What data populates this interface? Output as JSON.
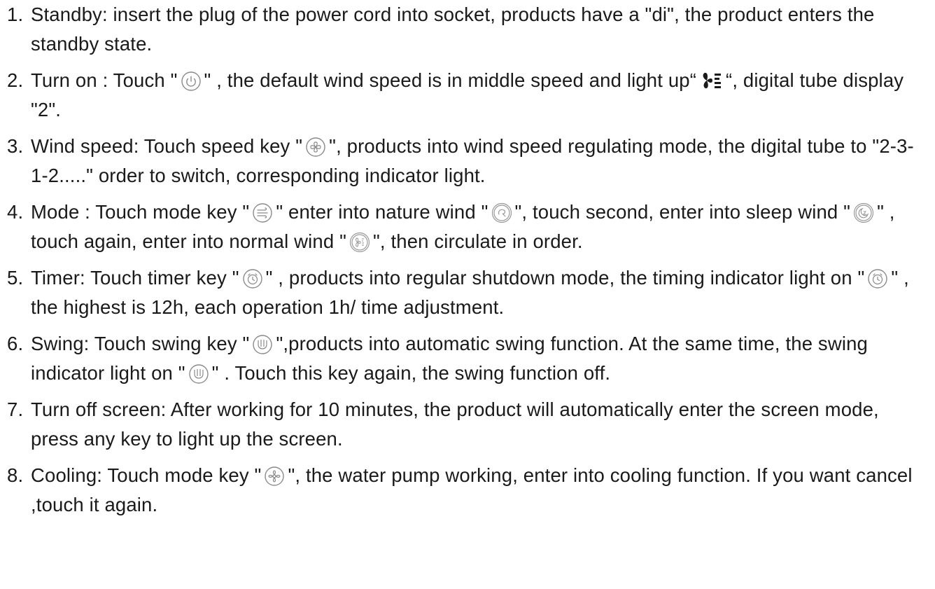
{
  "document": {
    "items": [
      {
        "number": "1.",
        "parts": [
          "Standby: insert the plug of the power cord into socket, products have a \"di\", the product enters the standby state."
        ]
      },
      {
        "number": "2.",
        "parts": [
          "Turn on : Touch \"",
          "\" , the default wind speed is in middle speed and light up“",
          "“, digital tube display \"2\"."
        ]
      },
      {
        "number": "3.",
        "parts": [
          "Wind speed: Touch speed key \"",
          "\", products into wind speed regulating mode, the digital tube to \"2-3-1-2.....\" order to switch, corresponding indicator light."
        ]
      },
      {
        "number": "4.",
        "parts": [
          "Mode : Touch mode key \"",
          "\" enter into nature wind \"",
          "\", touch second, enter into sleep wind \"",
          "\" , touch again, enter into normal wind \"",
          "\", then circulate in order."
        ]
      },
      {
        "number": "5.",
        "parts": [
          "Timer: Touch timer key \"",
          "\" , products into regular shutdown mode, the timing indicator light on \"",
          "\" , the highest is 12h, each operation 1h/ time adjustment."
        ]
      },
      {
        "number": "6.",
        "parts": [
          "Swing: Touch swing key \"",
          "\",products into automatic swing function. At the same time, the swing indicator light on \"",
          "\" . Touch this key again, the swing function off."
        ]
      },
      {
        "number": "7.",
        "parts": [
          "Turn off screen: After working for 10 minutes, the product will automatically enter the screen mode, press any key to light up the screen."
        ]
      },
      {
        "number": "8.",
        "parts": [
          "Cooling: Touch mode key \"",
          "\", the water pump working, enter into cooling function. If you want cancel ,touch it again."
        ]
      }
    ]
  },
  "icons": {
    "power": "power-icon",
    "fan_indicator": "fan-speed-indicator-icon",
    "speed": "fan-speed-icon",
    "mode": "mode-icon",
    "nature_wind": "nature-wind-icon",
    "sleep_wind": "sleep-wind-icon",
    "normal_wind": "normal-wind-icon",
    "timer": "timer-icon",
    "swing": "swing-icon",
    "cooling": "cooling-icon"
  },
  "colors": {
    "text": "#1a1a1a",
    "icon_stroke": "#8a8a8a"
  }
}
